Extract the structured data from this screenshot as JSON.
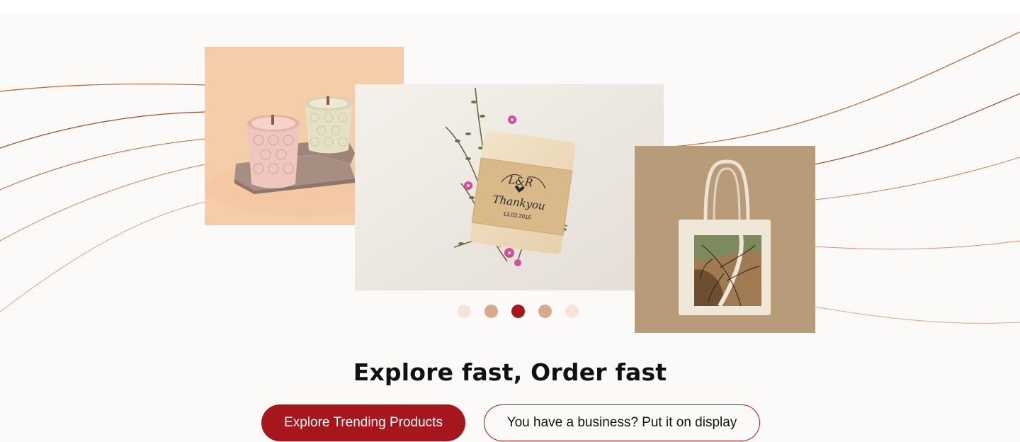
{
  "hero": {
    "headline": "Explore fast, Order fast",
    "primary_button": "Explore Trending Products",
    "secondary_button": "You have a business? Put it on display"
  },
  "carousel": {
    "center_image": {
      "label_initials": "L&R",
      "label_text": "Thankyou",
      "label_date": "13.03.2016"
    },
    "dots": [
      "#f8e3d8",
      "#d8a98a",
      "#a5161d",
      "#d8a98a",
      "#f8e3d8"
    ],
    "active_index": 2
  },
  "colors": {
    "accent": "#a5161d",
    "background": "#fcfaf8",
    "line": "#c0652f"
  }
}
